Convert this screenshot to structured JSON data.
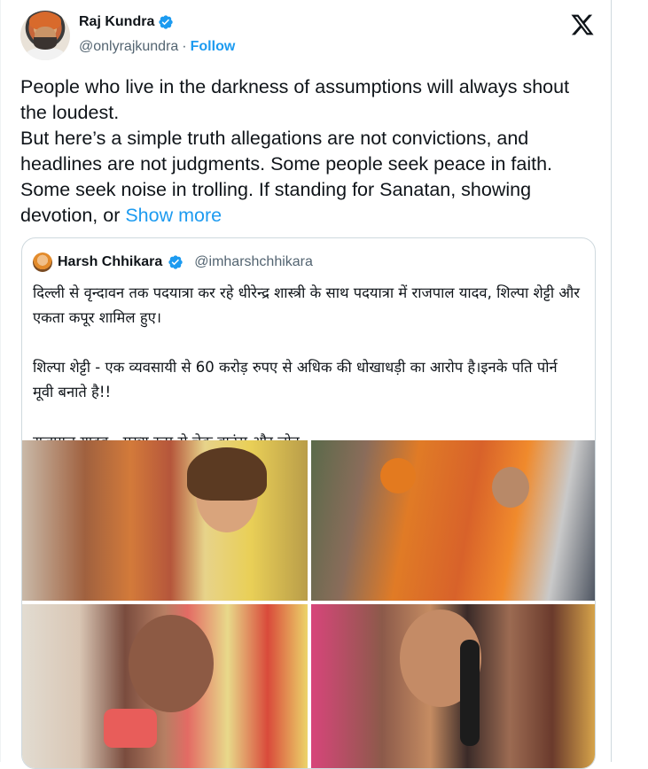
{
  "tweet": {
    "author": {
      "name": "Raj Kundra",
      "handle": "@onlyrajkundra",
      "separator": "·",
      "follow_label": "Follow"
    },
    "text_lines": [
      "People who live in the darkness of assumptions will always shout the loudest.",
      "But here’s a simple truth allegations are not convictions, and headlines are not judgments. Some people seek peace in faith. Some seek noise in trolling. If standing for Sanatan, showing devotion, or"
    ],
    "show_more_label": "Show more",
    "colors": {
      "accent": "#1d9bf0",
      "text": "#0f1419",
      "muted": "#536471"
    }
  },
  "quoted": {
    "author": {
      "name": "Harsh Chhikara",
      "handle": "@imharshchhikara"
    },
    "paragraphs": [
      "दिल्ली से वृन्दावन तक पदयात्रा कर रहे धीरेन्द्र शास्त्री के साथ पदयात्रा में राजपाल यादव, शिल्पा शेट्टी और एकता कपूर शामिल हुए।",
      "शिल्पा शेट्टी - एक व्यवसायी से 60 करोड़ रुपए से अधिक की धोखाधड़ी का आरोप है।इनके पति पोर्न मूवी बनाते है!!",
      "राजपाल यादव - मुख्य रूप से चेक बाउंस और लोन"
    ],
    "images": [
      "photo-1",
      "photo-2",
      "photo-3",
      "photo-4"
    ]
  },
  "icons": [
    "verified-badge-icon",
    "x-logo-icon"
  ]
}
